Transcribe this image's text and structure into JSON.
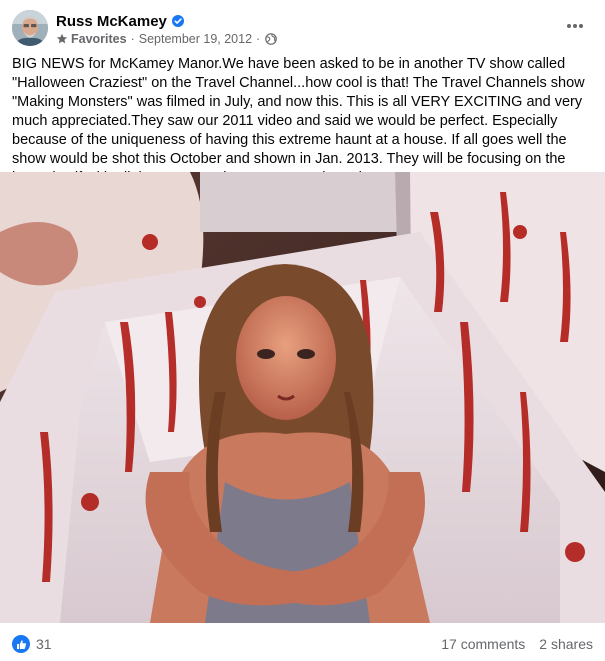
{
  "post": {
    "author": "Russ McKamey",
    "audience_label": "Favorites",
    "date": "September 19, 2012",
    "separator": "·",
    "text": "BIG NEWS for McKamey Manor.We have been asked to be in another TV show called \"Halloween Craziest\" on the Travel Channel...how cool is that! The Travel Channels show \"Making Monsters\" was filmed in July, and now this. This is all VERY EXCITING and very much appreciated.They saw our 2011 video and said we would be perfect. Especially because of the uniqueness of having this extreme haunt at a house.  If all goes well the show would be shot this October and shown in Jan. 2013. They will be focusing on the haunt itself with all the actors and guests. How about that!",
    "reaction_count": "31",
    "comments": "17 comments",
    "shares": "2 shares"
  },
  "icons": {
    "verified": "verified-badge-icon",
    "audience": "star-icon",
    "privacy": "globe-icon",
    "more": "more-options-icon",
    "like": "like-reaction-icon"
  },
  "colors": {
    "accent": "#1877f2",
    "secondary_text": "#65676b",
    "primary_text": "#050505"
  }
}
